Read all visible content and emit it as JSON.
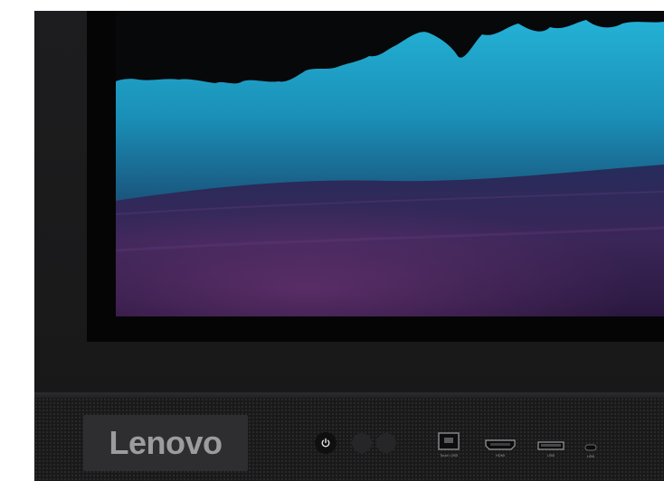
{
  "brand": {
    "logo_text": "Lenovo"
  },
  "controls": {
    "power_icon": "power-icon",
    "sensors": [
      "sensor",
      "sensor"
    ]
  },
  "ports": [
    {
      "label": "Touch USB",
      "icon": "usb-touch-port-icon"
    },
    {
      "label": "HDMI",
      "icon": "hdmi-port-icon"
    },
    {
      "label": "USB",
      "icon": "usb-port-icon"
    },
    {
      "label": "USB",
      "icon": "usb-c-port-icon"
    }
  ],
  "colors": {
    "bezel": "#1a1a1b",
    "screen_sky": "#1e9ec6",
    "screen_purple": "#4b2458",
    "logo": "#9c9c9f"
  }
}
